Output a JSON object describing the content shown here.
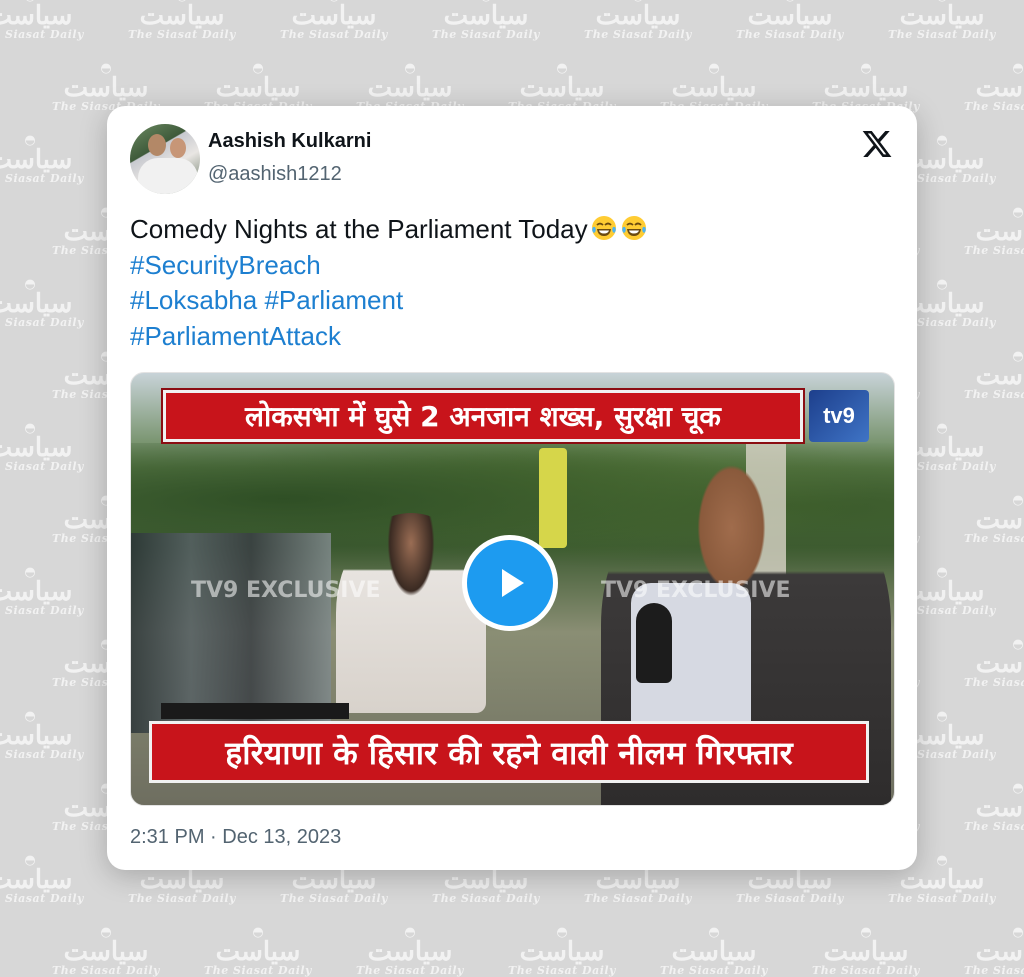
{
  "watermark": {
    "arabic": "سیاست",
    "english": "The Siasat Daily"
  },
  "tweet": {
    "author": {
      "name": "Aashish Kulkarni",
      "handle": "@aashish1212"
    },
    "text": {
      "line1": "Comedy Nights at the Parliament Today",
      "emoji_count": 2,
      "hashtags": [
        [
          "#SecurityBreach"
        ],
        [
          "#Loksabha",
          "#Parliament"
        ],
        [
          "#ParliamentAttack"
        ]
      ]
    },
    "media": {
      "headline_top": "लोकसभा में घुसे 2 अनजान शख्स, सुरक्षा चूक",
      "channel_logo": "tv9",
      "overlay_tag": "TV9 EXCLUSIVE",
      "headline_bottom": "हरियाणा के हिसार की रहने वाली नीलम गिरफ्तार",
      "play_icon": "play-icon"
    },
    "timestamp": {
      "time": "2:31 PM",
      "separator": "·",
      "date": "Dec 13, 2023"
    }
  },
  "colors": {
    "hashtag": "#1d7fd0",
    "play_button": "#1d9bf0",
    "banner_red": "#c8141b",
    "background": "#d7d7d7"
  }
}
